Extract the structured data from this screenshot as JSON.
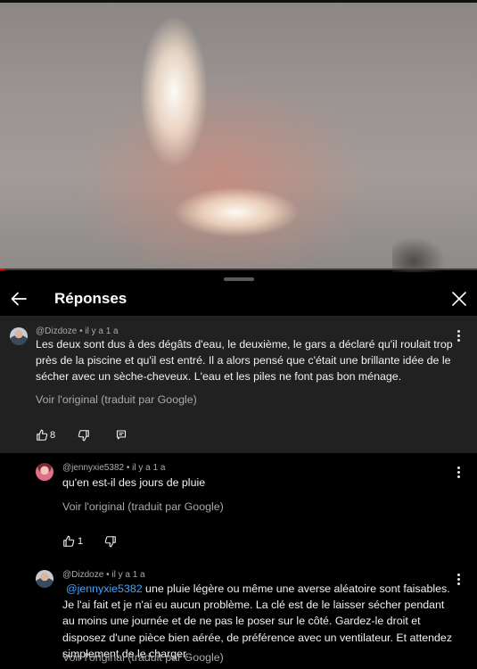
{
  "header": {
    "title": "Réponses"
  },
  "video": {
    "progress_fraction": 0.01
  },
  "comments": [
    {
      "author": "@Dizdoze",
      "separator": "•",
      "time": "il y a 1 a",
      "text": "Les deux sont dus à des dégâts d'eau, le deuxième, le gars a déclaré qu'il roulait trop près de la piscine et qu'il est entré. Il a alors pensé que c'était une brillante idée de le sécher avec un sèche-cheveux. L'eau et les piles ne font pas bon ménage.",
      "translate_label": "Voir l'original (traduit par Google)",
      "likes": "8"
    },
    {
      "author": "@jennyxie5382",
      "separator": "•",
      "time": "il y a 1 a",
      "text": "qu'en est-il des jours de pluie",
      "translate_label": "Voir l'original (traduit par Google)",
      "likes": "1"
    },
    {
      "author": "@Dizdoze",
      "separator": "•",
      "time": "il y a 1 a",
      "mention": "@jennyxie5382",
      "text": " une pluie légère ou même une averse aléatoire sont faisables. Je l'ai fait et je n'ai eu aucun problème. La clé est de le laisser sécher pendant au moins une journée et de ne pas le poser sur le côté. Gardez-le droit et disposez d'une pièce bien aérée, de préférence avec un ventilateur. Et attendez simplement de le charger.",
      "translate_label": "Voir l'original (traduit par Google)"
    }
  ],
  "icons": {
    "back": "arrow-left-icon",
    "close": "close-icon",
    "menu": "more-vert-icon",
    "like": "thumb-up-icon",
    "dislike": "thumb-down-icon",
    "reply": "reply-icon"
  },
  "colors": {
    "accent": "#3ea6ff",
    "progress": "#ff0000",
    "parent_bg": "#212121"
  }
}
